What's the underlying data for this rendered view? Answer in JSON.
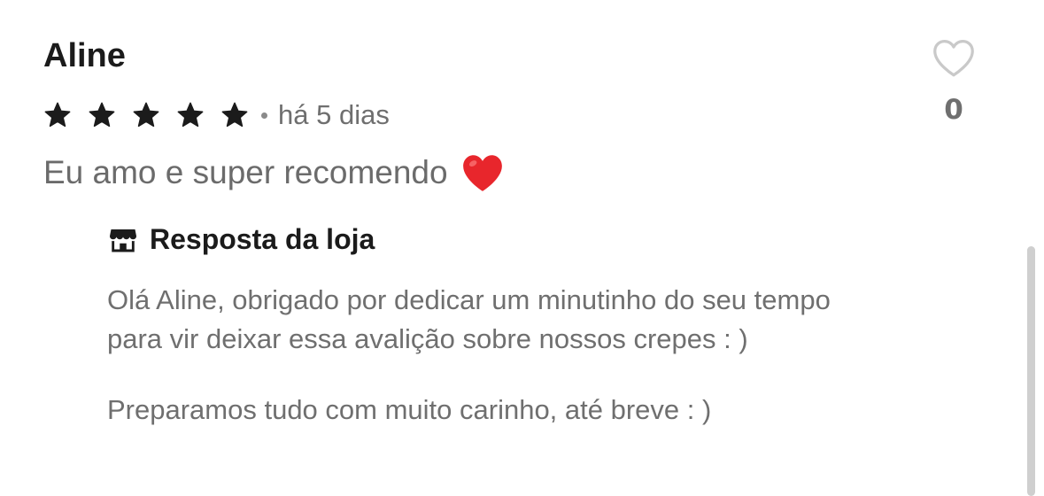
{
  "review": {
    "author": "Aline",
    "rating": 5,
    "date": "há 5 dias",
    "comment": "Eu amo e super recomendo",
    "comment_emoji": "heart-emoji",
    "likes": {
      "icon": "heart-outline-icon",
      "count": "0"
    }
  },
  "reply": {
    "icon": "store-icon",
    "title": "Resposta da loja",
    "lines": [
      "Olá Aline, obrigado por dedicar um minutinho do seu tempo",
      "para vir deixar essa avalição sobre nossos crepes : )"
    ],
    "closing": "Preparamos tudo com muito carinho, até breve : )"
  },
  "colors": {
    "text_dark": "#1b1b1b",
    "text_muted": "#6f6f6f",
    "heart_red": "#e8262c",
    "scrollbar": "#cfcfcf"
  }
}
